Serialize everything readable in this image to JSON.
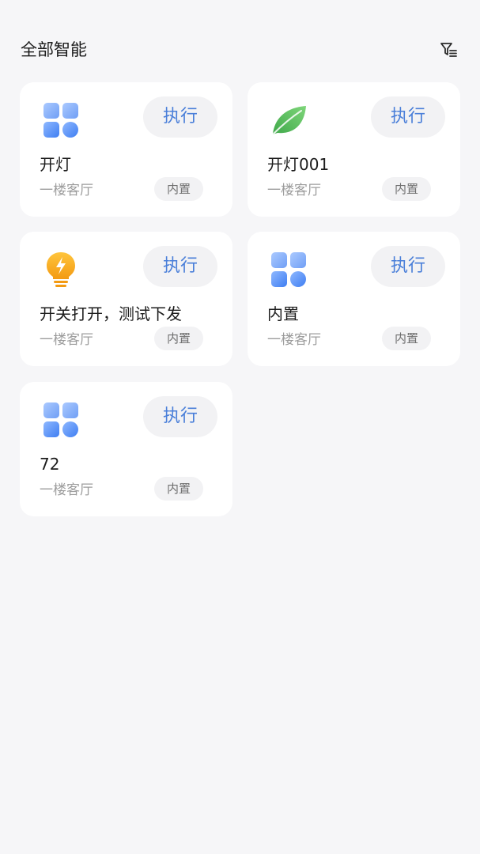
{
  "header": {
    "title": "全部智能",
    "filter_icon": "filter-list-icon"
  },
  "colors": {
    "background": "#f6f6f8",
    "card": "#ffffff",
    "accent": "#4a7fd9",
    "pill": "#f2f2f4",
    "leaf": "#4caf50",
    "bulb": "#f5a623"
  },
  "cards": [
    {
      "icon": "grid-apps-icon",
      "exec_label": "执行",
      "name": "开灯",
      "room": "一楼客厅",
      "tag": "内置"
    },
    {
      "icon": "leaf-icon",
      "exec_label": "执行",
      "name": "开灯001",
      "room": "一楼客厅",
      "tag": "内置"
    },
    {
      "icon": "lightbulb-icon",
      "exec_label": "执行",
      "name": "开关打开，测试下发",
      "room": "一楼客厅",
      "tag": "内置"
    },
    {
      "icon": "grid-apps-icon",
      "exec_label": "执行",
      "name": "内置",
      "room": "一楼客厅",
      "tag": "内置"
    },
    {
      "icon": "grid-apps-icon",
      "exec_label": "执行",
      "name": "72",
      "room": "一楼客厅",
      "tag": "内置"
    }
  ]
}
